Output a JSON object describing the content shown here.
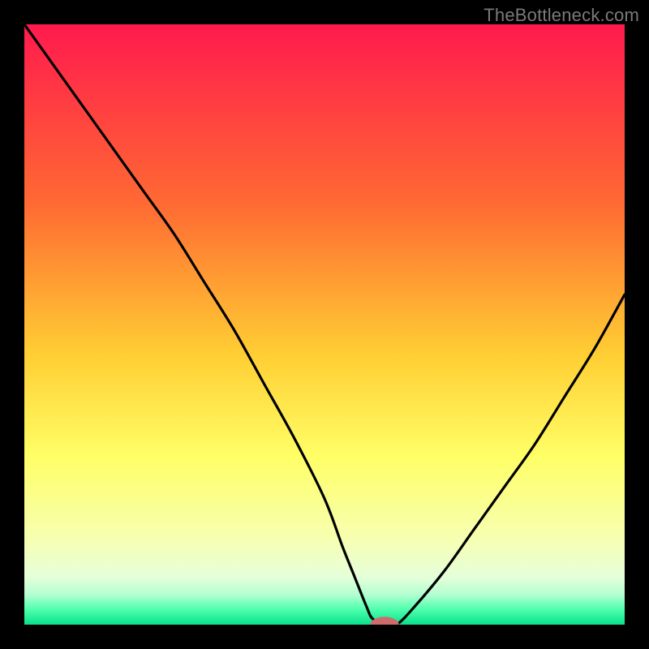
{
  "watermark": "TheBottleneck.com",
  "colors": {
    "frame": "#000000",
    "gradient_stops": [
      {
        "offset": 0.0,
        "color": "#ff1a4d"
      },
      {
        "offset": 0.3,
        "color": "#ff6a33"
      },
      {
        "offset": 0.55,
        "color": "#ffce33"
      },
      {
        "offset": 0.72,
        "color": "#ffff66"
      },
      {
        "offset": 0.86,
        "color": "#f6ffb3"
      },
      {
        "offset": 0.92,
        "color": "#e6ffd9"
      },
      {
        "offset": 0.95,
        "color": "#b3ffd1"
      },
      {
        "offset": 0.975,
        "color": "#4dffad"
      },
      {
        "offset": 1.0,
        "color": "#08e08a"
      }
    ],
    "curve": "#000000",
    "marker_fill": "#cf6b6b",
    "marker_stroke": "#cf6b6b"
  },
  "chart_data": {
    "type": "line",
    "title": "",
    "xlabel": "",
    "ylabel": "",
    "xlim": [
      0,
      100
    ],
    "ylim": [
      0,
      100
    ],
    "grid": false,
    "legend": false,
    "series": [
      {
        "name": "bottleneck-curve",
        "x": [
          0,
          5,
          10,
          15,
          20,
          25,
          30,
          35,
          40,
          45,
          50,
          53,
          55,
          57,
          58,
          60,
          62,
          65,
          70,
          75,
          80,
          85,
          90,
          95,
          100
        ],
        "y": [
          100,
          93,
          86,
          79,
          72,
          65,
          57,
          49,
          40,
          31,
          21,
          13,
          8,
          3,
          1,
          0,
          0,
          3,
          9,
          16,
          23,
          30,
          38,
          46,
          55
        ]
      }
    ],
    "marker": {
      "x": 60,
      "y": 0,
      "rx": 2.3,
      "ry": 1.2
    },
    "annotations": []
  }
}
